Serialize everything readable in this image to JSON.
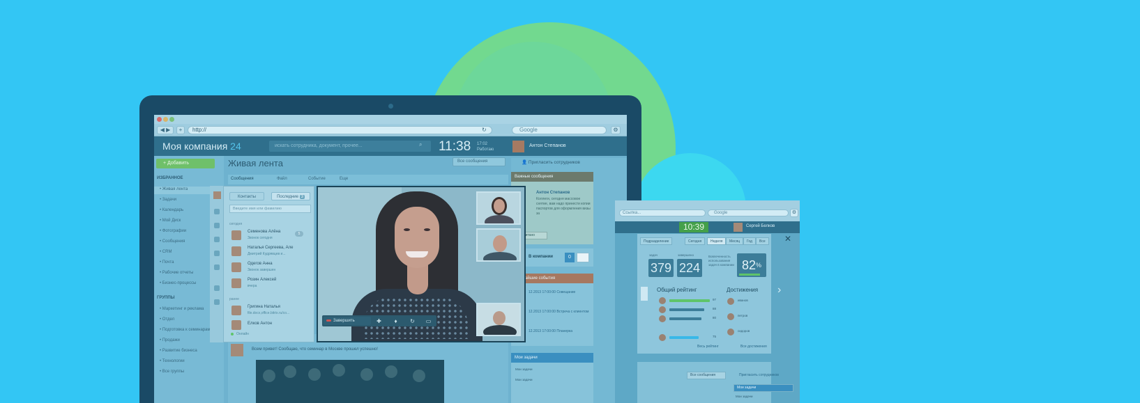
{
  "browser": {
    "url": "http://",
    "search_placeholder": "Google",
    "back_label": "◀ ▶",
    "add_label": "+"
  },
  "app": {
    "brand": "Моя компания",
    "brand_suffix": "24",
    "search_placeholder": "искать сотрудника, документ, прочее...",
    "clock": "11:38",
    "clock_meta": "17:02\nРаботаю",
    "user_name": "Антон Степанов",
    "add_button": "+ Добавить"
  },
  "sidebar": {
    "favorites_header": "ИЗБРАННОЕ",
    "items": [
      "Живая лента",
      "Задачи",
      "Календарь",
      "Мой Диск",
      "Фотографии",
      "Сообщения",
      "CRM",
      "Почта",
      "Рабочие отчеты",
      "Бизнес-процессы"
    ],
    "groups_header": "ГРУППЫ",
    "groups": [
      "Маркетинг и реклама",
      "Отдел",
      "Подготовка к семинарам",
      "Продажи",
      "Развитие бизнеса",
      "Технологии",
      "Все группы"
    ]
  },
  "main": {
    "title": "Живая лента",
    "filter": "Все сообщения",
    "invite": "Пригласить сотрудников",
    "tabs": [
      "Сообщения",
      "Файл",
      "Событие",
      "Еще"
    ],
    "feed_text": "Всем привет! Сообщаю, что семинар в Москве прошел успешно!"
  },
  "contacts": {
    "tab_contacts": "Контакты",
    "tab_recent": "Последние",
    "recent_badge": "3",
    "search_placeholder": "Введите имя или фамилию",
    "group_today": "сегодня",
    "group_earlier": "ранее",
    "people": [
      {
        "name": "Семенова Алёна",
        "sub": "Звонок сегодня"
      },
      {
        "name": "Наталья Сергеева, Але",
        "sub": "Дмитрий Кудрявцев и..."
      },
      {
        "name": "Одегов Анна",
        "sub": "Звонок завершен"
      },
      {
        "name": "Розин Алексей",
        "sub": "вчера"
      },
      {
        "name": "Григина Наталья",
        "sub": "file.docx,office.bitrix.ru/co..."
      },
      {
        "name": "Елков Антон",
        "sub": ""
      }
    ],
    "unread_badge": "5",
    "status": "Онлайн"
  },
  "call": {
    "end_label": "Завершить"
  },
  "right": {
    "important_header": "Важные сообщения",
    "important_author": "Антон Степанов",
    "important_text": "Коллеги, сегодня массовое снятие, вам надо принести копии паспортов для оформления визы за",
    "important_read": "Прочитано",
    "company_label": "В компании",
    "company_count": "0",
    "events_header": "Ближайшие события",
    "events": [
      "12.2013 17:00:00 Совещание",
      "12.2013 17:00:00 Встреча с клиентом",
      "12.2013 17:00:00 Планерка"
    ],
    "tasks_header": "Мои задачи",
    "tasks": [
      "Мои задачи",
      "Мои задачи"
    ]
  },
  "tablet": {
    "url": "Ссылка...",
    "search": "Google",
    "clock": "10:39",
    "user_name": "Сергей Белков",
    "tabs": [
      "Подразделение",
      "Сегодня",
      "Неделя",
      "Месяц",
      "Год",
      "Все"
    ],
    "stat1_label": "задач",
    "stat1": "379",
    "stat2_label": "завершено",
    "stat2": "224",
    "desc": "Вовлеченность использования задач в компании",
    "percent": "82",
    "percent_sign": "%",
    "rating_title": "Общий рейтинг",
    "achievements_title": "Достижения",
    "rating_values": [
      "97",
      "88",
      "80",
      "75"
    ],
    "all_rating": "Весь рейтинг",
    "all_achievements": "Все достижения",
    "achievers": [
      "иванов",
      "петров",
      "сидоров"
    ],
    "filter": "Все сообщения",
    "invite": "Пригласить сотрудников",
    "tasks_header": "Мои задачи",
    "tasks": [
      "Мои задачи"
    ]
  }
}
